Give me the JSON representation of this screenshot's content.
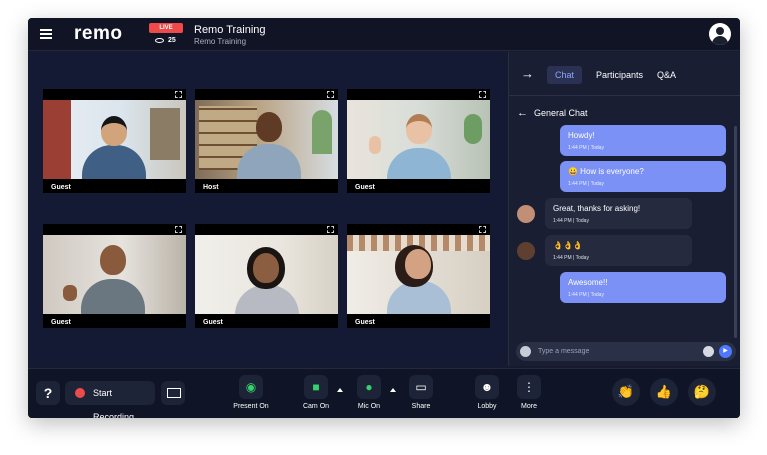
{
  "app": {
    "logo": "remo",
    "live_badge": "LIVE",
    "viewer_count": "25",
    "title": "Remo Training",
    "subtitle": "Remo Training"
  },
  "tiles": [
    {
      "label": "Guest"
    },
    {
      "label": "Host"
    },
    {
      "label": "Guest"
    },
    {
      "label": "Guest"
    },
    {
      "label": "Guest"
    },
    {
      "label": "Guest"
    }
  ],
  "chat": {
    "tabs": [
      "Chat",
      "Participants",
      "Q&A"
    ],
    "active_tab": "Chat",
    "channel": "General Chat",
    "messages": [
      {
        "text": "Howdy!",
        "time": "1:44 PM | Today",
        "sender": "me"
      },
      {
        "text": "😀 How is everyone?",
        "time": "1:44 PM | Today",
        "sender": "me"
      },
      {
        "text": "Great, thanks for asking!",
        "time": "1:44 PM | Today",
        "sender": "other"
      },
      {
        "text": "👌👌👌",
        "time": "1:44 PM | Today",
        "sender": "other"
      },
      {
        "text": "Awesome!!",
        "time": "1:44 PM | Today",
        "sender": "me"
      }
    ],
    "input_placeholder": "Type a message"
  },
  "toolbar": {
    "help": "?",
    "record_label": "Start Recording",
    "present_label": "Present On",
    "cam_label": "Cam On",
    "mic_label": "Mic On",
    "share_label": "Share",
    "lobby_label": "Lobby",
    "more_label": "More",
    "reactions": [
      "👏",
      "👍",
      "🤔"
    ]
  },
  "colors": {
    "accent": "#7b91f5",
    "live": "#ef4a4a",
    "active_green": "#34d36a",
    "background": "#151a2e"
  }
}
